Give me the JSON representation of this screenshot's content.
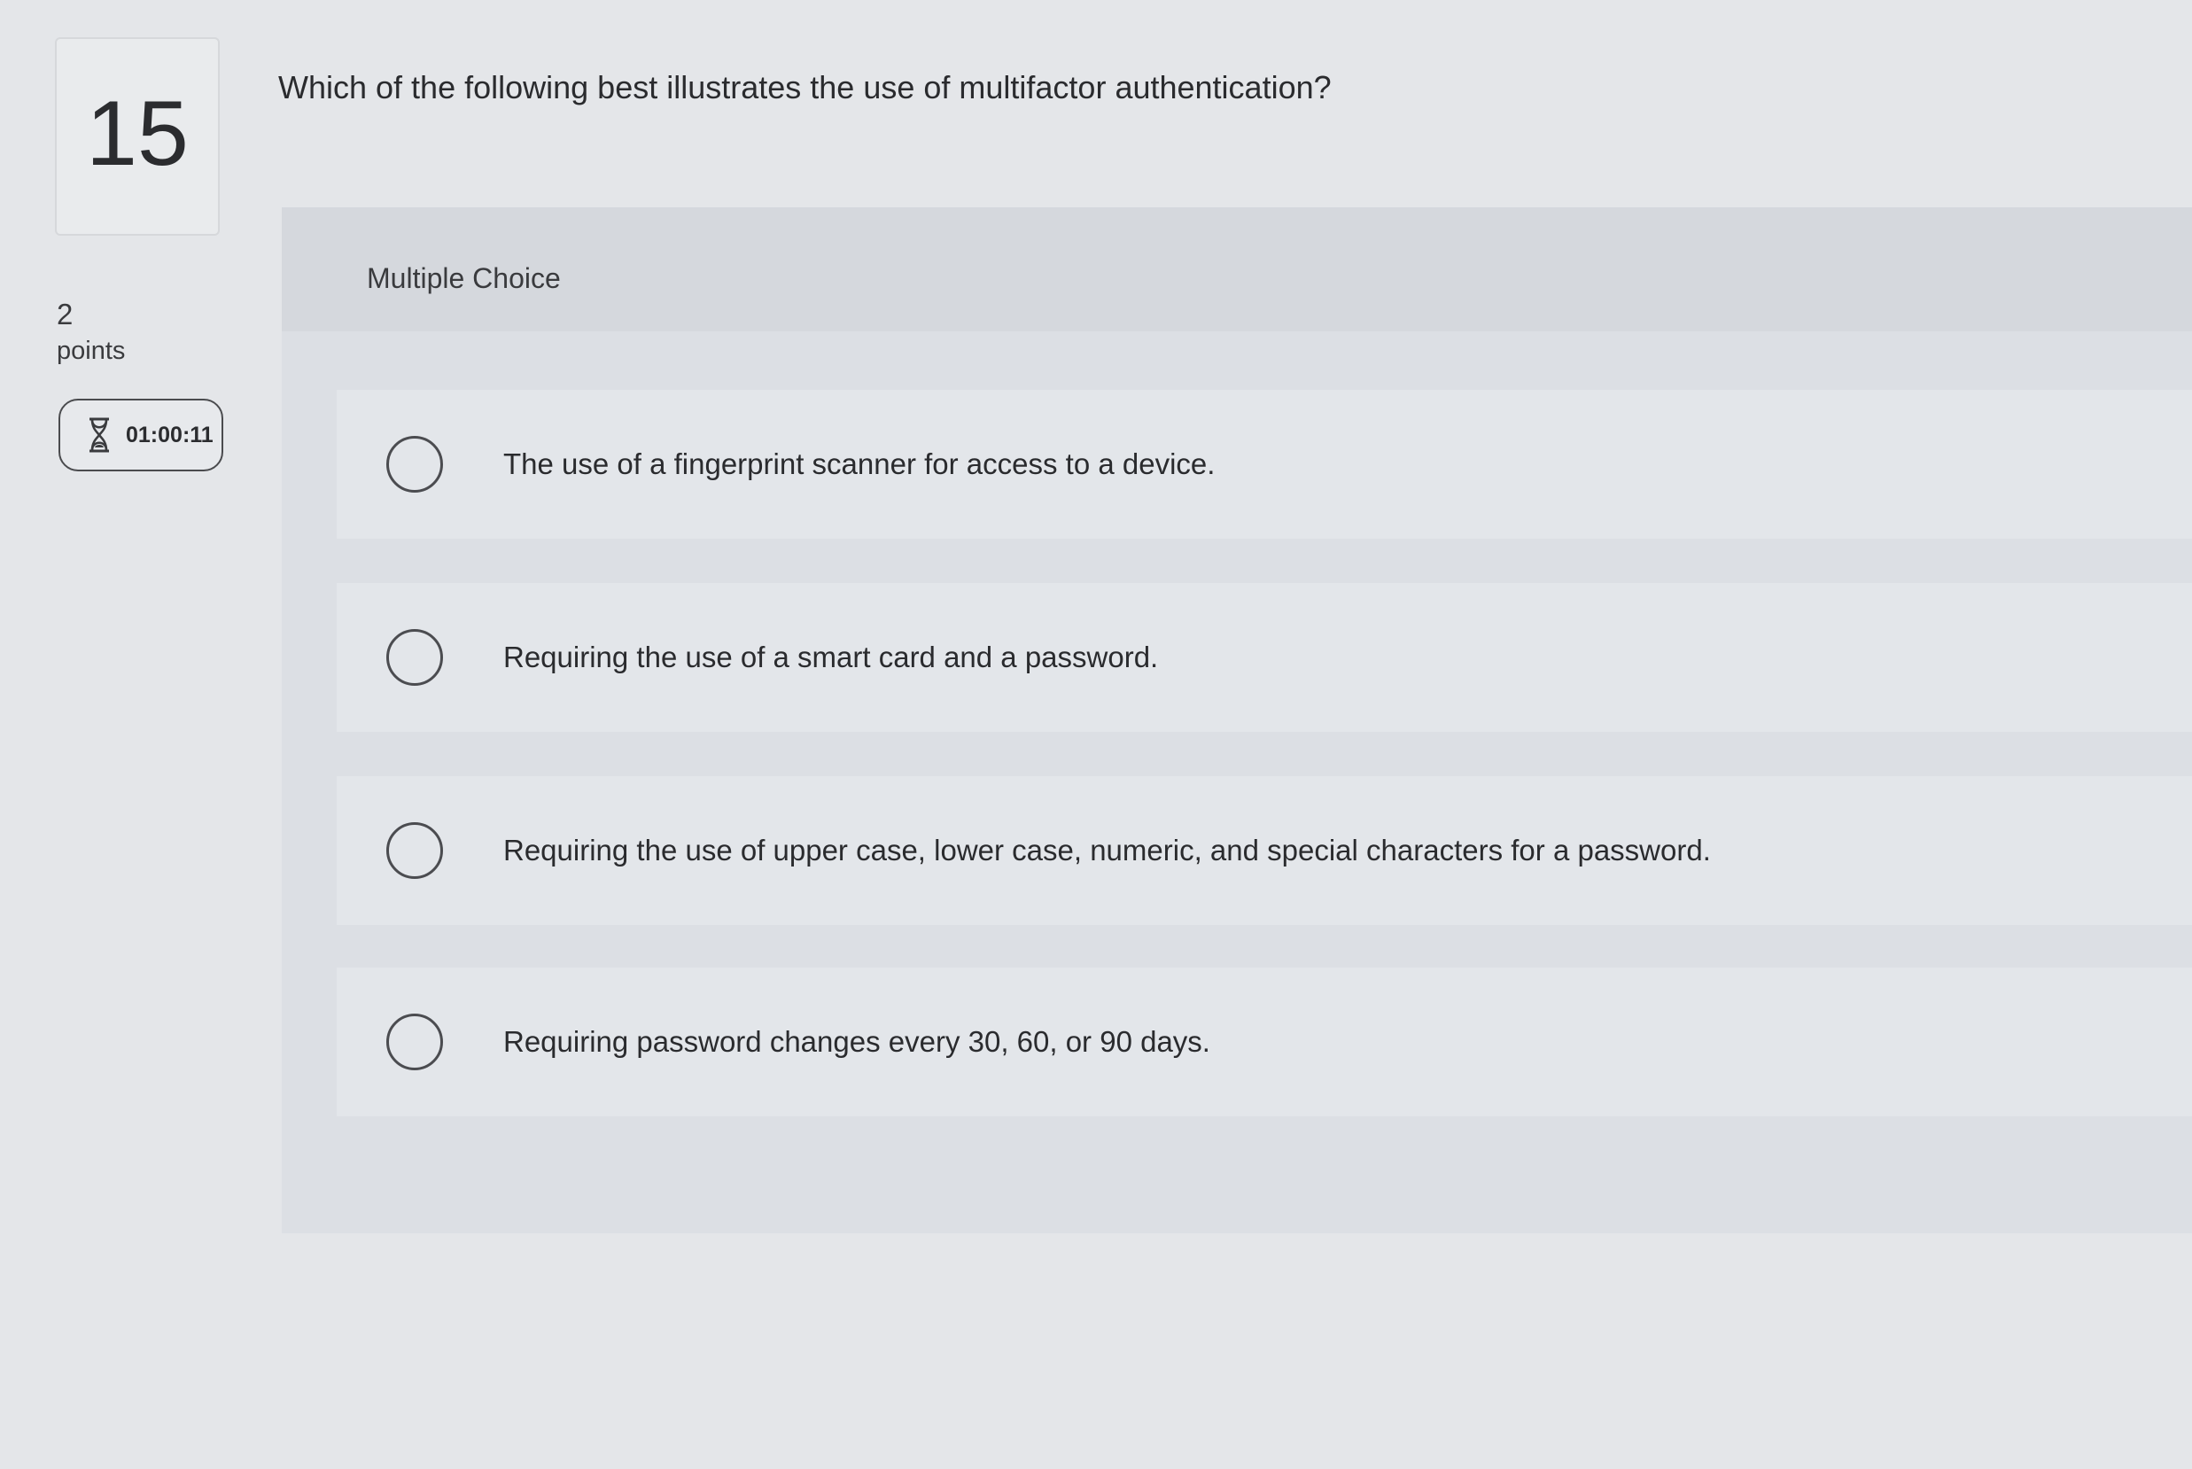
{
  "question": {
    "number": "15",
    "points_value": "2",
    "points_label": "points",
    "timer": "01:00:11",
    "timer_icon": "hourglass-icon",
    "text": "Which of the following best illustrates the use of multifactor authentication?"
  },
  "answer_panel": {
    "type_label": "Multiple Choice",
    "options": [
      {
        "label": "The use of a fingerprint scanner for access to a device."
      },
      {
        "label": "Requiring the use of a smart card and a password."
      },
      {
        "label": "Requiring the use of upper case, lower case, numeric, and special characters for a password."
      },
      {
        "label": "Requiring password changes every 30, 60, or 90 days."
      }
    ]
  }
}
